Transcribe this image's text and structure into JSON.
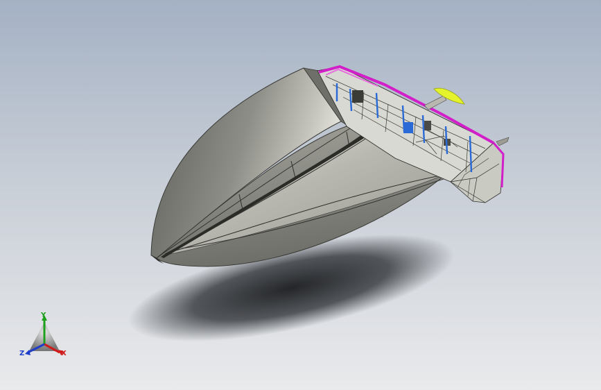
{
  "viewport": {
    "background_top": "#a4b1c4",
    "background_bottom": "#e9eaec"
  },
  "model": {
    "hull_color": "#8f8f88",
    "deck_color": "#dadbd3",
    "section_edge_color": "#d21fc9",
    "bulkhead_color": "#2a6ad6",
    "rudder_color": "#e5f32c"
  },
  "triad": {
    "x_label": "X",
    "y_label": "Y",
    "z_label": "Z",
    "x_color": "#d01a1a",
    "y_color": "#1ea01e",
    "z_color": "#1f3ec8"
  }
}
